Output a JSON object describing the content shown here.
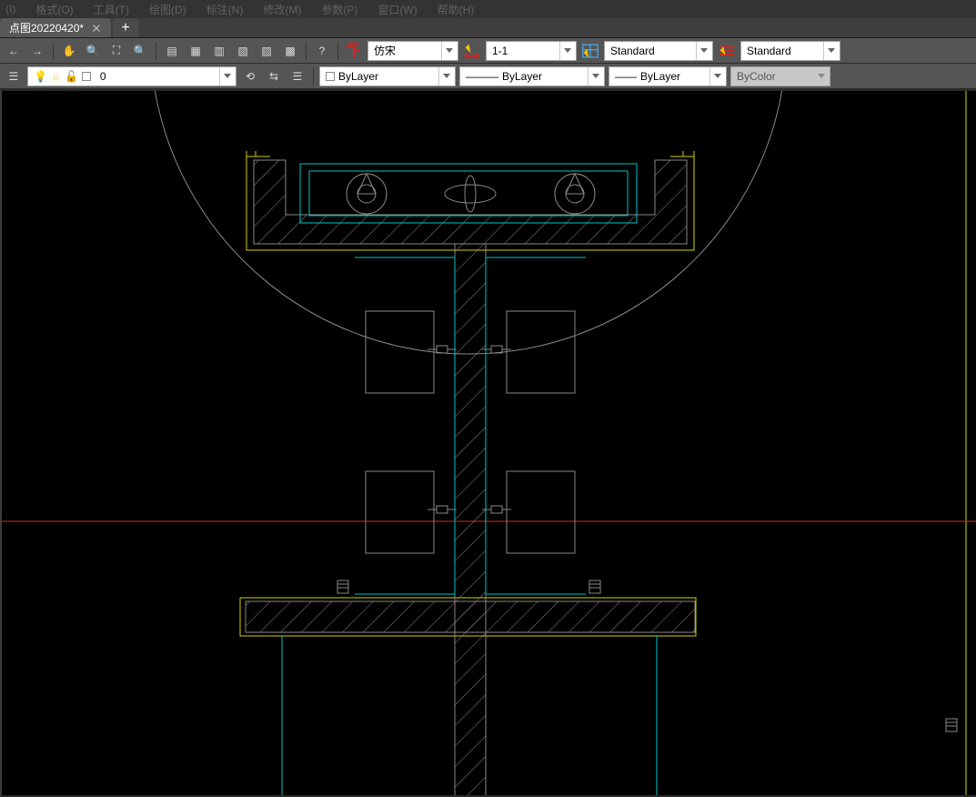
{
  "menu": {
    "items": [
      "(I)",
      "格式(O)",
      "工具(T)",
      "绘图(D)",
      "标注(N)",
      "修改(M)",
      "参数(P)",
      "窗口(W)",
      "帮助(H)"
    ]
  },
  "tabs": {
    "active": {
      "title": "点图20220420*"
    },
    "newTabTooltip": "+"
  },
  "toolbar1": {
    "navBack": "←",
    "navForward": "→",
    "textStyle": {
      "value": "仿宋"
    },
    "dimStyle": {
      "value": "1-1"
    },
    "tableStyle": {
      "value": "Standard"
    },
    "mlStyle": {
      "value": "Standard"
    }
  },
  "toolbar2": {
    "layer": {
      "value": "0"
    },
    "color": {
      "value": "ByLayer"
    },
    "linetype": {
      "value": "ByLayer",
      "sample": "———"
    },
    "lineweight": {
      "value": "ByLayer",
      "sample": "——"
    },
    "plotstyle": {
      "value": "ByColor"
    }
  }
}
